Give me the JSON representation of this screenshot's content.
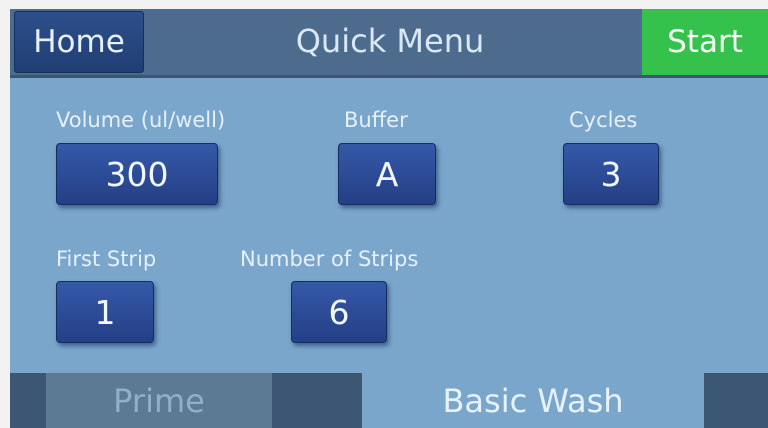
{
  "header": {
    "home_label": "Home",
    "title": "Quick Menu",
    "start_label": "Start"
  },
  "fields": {
    "volume": {
      "label": "Volume (ul/well)",
      "value": "300"
    },
    "buffer": {
      "label": "Buffer",
      "value": "A"
    },
    "cycles": {
      "label": "Cycles",
      "value": "3"
    },
    "first_strip": {
      "label": "First Strip",
      "value": "1"
    },
    "number_of_strips": {
      "label": "Number of Strips",
      "value": "6"
    }
  },
  "tabs": [
    {
      "label": "Prime",
      "active": false
    },
    {
      "label": "Basic Wash",
      "active": true
    }
  ],
  "colors": {
    "screen_bg": "#7aa6cc",
    "header_bg": "#4d6b8c",
    "start_green": "#34c24c",
    "button_blue": "#2b4c96"
  }
}
